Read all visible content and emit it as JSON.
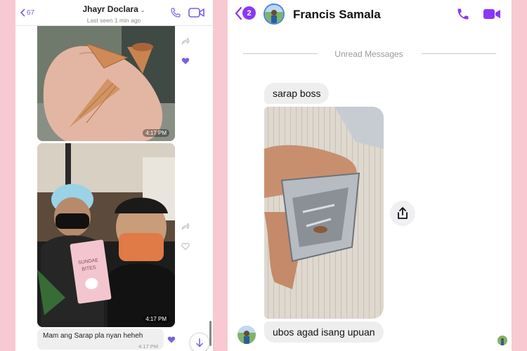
{
  "left_chat": {
    "back_count": "67",
    "contact_name": "Jhayr Doclara",
    "status": "Last seen 1 min ago",
    "messages": [
      {
        "type": "photo",
        "subject": "ice cream cones in hand",
        "time": "4:17 PM"
      },
      {
        "type": "photo",
        "subject": "selfie with Sundae Bites pack",
        "time": "4:17 PM"
      },
      {
        "type": "text",
        "text": "Mam ang Sarap pla nyan heheh",
        "time": "4:17 PM"
      }
    ],
    "accent_color": "#7b5ee6"
  },
  "right_chat": {
    "unread_badge": "2",
    "contact_name": "Francis Samala",
    "divider_label": "Unread Messages",
    "messages": [
      {
        "type": "text",
        "text": "sarap boss"
      },
      {
        "type": "photo",
        "subject": "empty foil snack pouch"
      },
      {
        "type": "text",
        "text": "ubos agad isang upuan"
      }
    ],
    "accent_color": "#8a38f5"
  }
}
